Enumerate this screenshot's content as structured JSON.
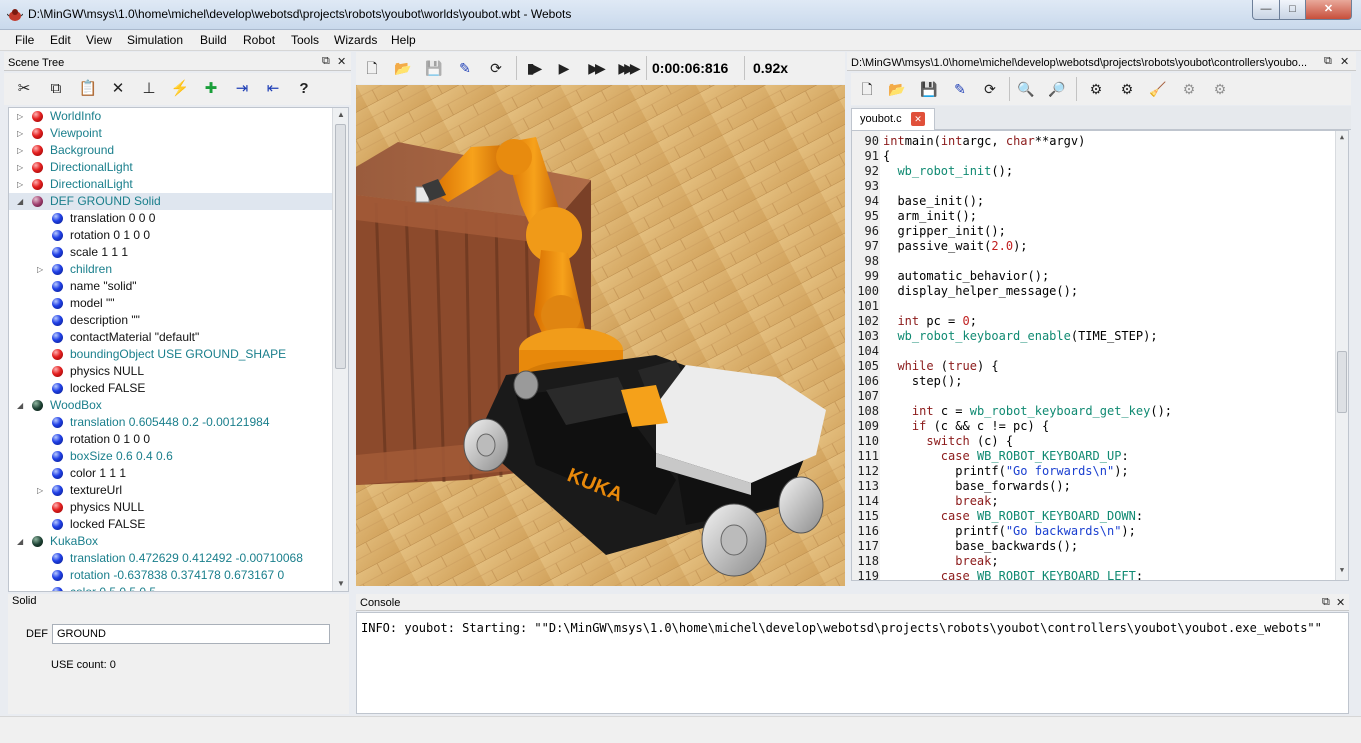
{
  "window": {
    "title": "D:\\MinGW\\msys\\1.0\\home\\michel\\develop\\webotsd\\projects\\robots\\youbot\\worlds\\youbot.wbt - Webots",
    "min_label": "—",
    "max_label": "□",
    "close_label": "✕"
  },
  "menu": [
    "File",
    "Edit",
    "View",
    "Simulation",
    "Build",
    "Robot",
    "Tools",
    "Wizards",
    "Help"
  ],
  "scene_tree": {
    "title": "Scene Tree",
    "toolbar_icons": [
      "cut-icon",
      "copy-icon",
      "paste-icon",
      "delete-icon",
      "reset-icon",
      "lightning-icon",
      "add-node-icon",
      "import-icon",
      "export-icon",
      "help-icon"
    ],
    "toolbar_glyphs": [
      "✂",
      "⧉",
      "📋",
      "✕",
      "⊥",
      "⚡",
      "✚",
      "⇥",
      "⇤",
      "?"
    ],
    "nodes": [
      {
        "label": "WorldInfo",
        "ball": "red",
        "depth": 0,
        "arrow": "▷",
        "color": "teal"
      },
      {
        "label": "Viewpoint",
        "ball": "red",
        "depth": 0,
        "arrow": "▷",
        "color": "teal"
      },
      {
        "label": "Background",
        "ball": "red",
        "depth": 0,
        "arrow": "▷",
        "color": "teal"
      },
      {
        "label": "DirectionalLight",
        "ball": "red",
        "depth": 0,
        "arrow": "▷",
        "color": "teal"
      },
      {
        "label": "DirectionalLight",
        "ball": "red",
        "depth": 0,
        "arrow": "▷",
        "color": "teal"
      },
      {
        "label": "DEF GROUND Solid",
        "ball": "mauve",
        "depth": 0,
        "arrow": "◢",
        "color": "teal",
        "selected": true
      },
      {
        "label": "translation 0 0 0",
        "ball": "blue",
        "depth": 1,
        "arrow": "",
        "color": "black"
      },
      {
        "label": "rotation 0 1 0 0",
        "ball": "blue",
        "depth": 1,
        "arrow": "",
        "color": "black"
      },
      {
        "label": "scale 1 1 1",
        "ball": "blue",
        "depth": 1,
        "arrow": "",
        "color": "black"
      },
      {
        "label": "children",
        "ball": "blue",
        "depth": 1,
        "arrow": "▷",
        "color": "teal"
      },
      {
        "label": "name \"solid\"",
        "ball": "blue",
        "depth": 1,
        "arrow": "",
        "color": "black"
      },
      {
        "label": "model \"\"",
        "ball": "blue",
        "depth": 1,
        "arrow": "",
        "color": "black"
      },
      {
        "label": "description \"\"",
        "ball": "blue",
        "depth": 1,
        "arrow": "",
        "color": "black"
      },
      {
        "label": "contactMaterial \"default\"",
        "ball": "blue",
        "depth": 1,
        "arrow": "",
        "color": "black"
      },
      {
        "label": "boundingObject USE GROUND_SHAPE",
        "ball": "red",
        "depth": 1,
        "arrow": "",
        "color": "teal"
      },
      {
        "label": "physics NULL",
        "ball": "red",
        "depth": 1,
        "arrow": "",
        "color": "black"
      },
      {
        "label": "locked FALSE",
        "ball": "blue",
        "depth": 1,
        "arrow": "",
        "color": "black"
      },
      {
        "label": "WoodBox",
        "ball": "dark",
        "depth": 0,
        "arrow": "◢",
        "color": "teal"
      },
      {
        "label": "translation 0.605448 0.2 -0.00121984",
        "ball": "blue",
        "depth": 1,
        "arrow": "",
        "color": "teal"
      },
      {
        "label": "rotation 0 1 0 0",
        "ball": "blue",
        "depth": 1,
        "arrow": "",
        "color": "black"
      },
      {
        "label": "boxSize 0.6 0.4 0.6",
        "ball": "blue",
        "depth": 1,
        "arrow": "",
        "color": "teal"
      },
      {
        "label": "color 1 1 1",
        "ball": "blue",
        "depth": 1,
        "arrow": "",
        "color": "black"
      },
      {
        "label": "textureUrl",
        "ball": "blue",
        "depth": 1,
        "arrow": "▷",
        "color": "black"
      },
      {
        "label": "physics NULL",
        "ball": "red",
        "depth": 1,
        "arrow": "",
        "color": "black"
      },
      {
        "label": "locked FALSE",
        "ball": "blue",
        "depth": 1,
        "arrow": "",
        "color": "black"
      },
      {
        "label": "KukaBox",
        "ball": "dark",
        "depth": 0,
        "arrow": "◢",
        "color": "teal"
      },
      {
        "label": "translation 0.472629 0.412492 -0.00710068",
        "ball": "blue",
        "depth": 1,
        "arrow": "",
        "color": "teal"
      },
      {
        "label": "rotation -0.637838 0.374178 0.673167 0",
        "ball": "blue",
        "depth": 1,
        "arrow": "",
        "color": "teal"
      },
      {
        "label": "color 0.5 0.5 0.5",
        "ball": "blue",
        "depth": 1,
        "arrow": "",
        "color": "teal"
      }
    ]
  },
  "field_editor": {
    "title": "Solid",
    "def_label": "DEF",
    "def_value": "GROUND",
    "use_count": "USE count: 0"
  },
  "sim_toolbar": {
    "icons": [
      "new-world-icon",
      "open-world-icon",
      "save-world-icon",
      "edit-icon",
      "reload-icon",
      "step-icon",
      "play-icon",
      "fast-icon",
      "fastest-icon"
    ],
    "glyphs": [
      "🗋",
      "📂",
      "💾",
      "✎",
      "⟳",
      "▮▶",
      "▶",
      "▶▶",
      "▶▶▶"
    ],
    "time": "0:00:06:816",
    "speed": "0.92x"
  },
  "editor": {
    "title": "D:\\MinGW\\msys\\1.0\\home\\michel\\develop\\webotsd\\projects\\robots\\youbot\\controllers\\youbo...",
    "tab_label": "youbot.c",
    "tab_close": "✕",
    "toolbar_icons": [
      "new-file-icon",
      "open-file-icon",
      "save-file-icon",
      "save-as-icon",
      "revert-icon",
      "find-icon",
      "replace-icon",
      "build-icon",
      "make-icon",
      "clean-icon",
      "cross-compile-icon",
      "cross-clean-icon"
    ],
    "toolbar_glyphs": [
      "🗋",
      "📂",
      "💾",
      "✎",
      "⟳",
      "🔍",
      "🔎",
      "⚙",
      "⚙",
      "🧹",
      "⚙",
      "⚙"
    ],
    "lines": [
      {
        "n": "90",
        "tokens": [
          [
            "kw",
            "int"
          ],
          [
            "",
            "main("
          ],
          [
            "kw",
            "int"
          ],
          [
            "",
            "argc, "
          ],
          [
            "kw",
            "char"
          ],
          [
            "",
            "**argv)"
          ]
        ]
      },
      {
        "n": "91",
        "tokens": [
          [
            "",
            "{"
          ]
        ]
      },
      {
        "n": "92",
        "tokens": [
          [
            "",
            "  "
          ],
          [
            "fn",
            "wb_robot_init"
          ],
          [
            "",
            "();"
          ]
        ]
      },
      {
        "n": "93",
        "tokens": [
          [
            "",
            ""
          ]
        ]
      },
      {
        "n": "94",
        "tokens": [
          [
            "",
            "  base_init();"
          ]
        ]
      },
      {
        "n": "95",
        "tokens": [
          [
            "",
            "  arm_init();"
          ]
        ]
      },
      {
        "n": "96",
        "tokens": [
          [
            "",
            "  gripper_init();"
          ]
        ]
      },
      {
        "n": "97",
        "tokens": [
          [
            "",
            "  passive_wait("
          ],
          [
            "num",
            "2.0"
          ],
          [
            "",
            ");"
          ]
        ]
      },
      {
        "n": "98",
        "tokens": [
          [
            "",
            ""
          ]
        ]
      },
      {
        "n": "99",
        "tokens": [
          [
            "",
            "  automatic_behavior();"
          ]
        ]
      },
      {
        "n": "100",
        "tokens": [
          [
            "",
            "  display_helper_message();"
          ]
        ]
      },
      {
        "n": "101",
        "tokens": [
          [
            "",
            ""
          ]
        ]
      },
      {
        "n": "102",
        "tokens": [
          [
            "",
            "  "
          ],
          [
            "kw",
            "int"
          ],
          [
            "",
            " pc = "
          ],
          [
            "num",
            "0"
          ],
          [
            "",
            ";"
          ]
        ]
      },
      {
        "n": "103",
        "tokens": [
          [
            "",
            "  "
          ],
          [
            "fn",
            "wb_robot_keyboard_enable"
          ],
          [
            "",
            "(TIME_STEP);"
          ]
        ]
      },
      {
        "n": "104",
        "tokens": [
          [
            "",
            ""
          ]
        ]
      },
      {
        "n": "105",
        "tokens": [
          [
            "",
            "  "
          ],
          [
            "kw",
            "while"
          ],
          [
            "",
            " ("
          ],
          [
            "kw",
            "true"
          ],
          [
            "",
            ") {"
          ]
        ]
      },
      {
        "n": "106",
        "tokens": [
          [
            "",
            "    step();"
          ]
        ]
      },
      {
        "n": "107",
        "tokens": [
          [
            "",
            ""
          ]
        ]
      },
      {
        "n": "108",
        "tokens": [
          [
            "",
            "    "
          ],
          [
            "kw",
            "int"
          ],
          [
            "",
            " c = "
          ],
          [
            "fn",
            "wb_robot_keyboard_get_key"
          ],
          [
            "",
            "();"
          ]
        ]
      },
      {
        "n": "109",
        "tokens": [
          [
            "",
            "    "
          ],
          [
            "kw",
            "if"
          ],
          [
            "",
            " (c && c != pc) {"
          ]
        ]
      },
      {
        "n": "110",
        "tokens": [
          [
            "",
            "      "
          ],
          [
            "kw",
            "switch"
          ],
          [
            "",
            " (c) {"
          ]
        ]
      },
      {
        "n": "111",
        "tokens": [
          [
            "",
            "        "
          ],
          [
            "kw",
            "case"
          ],
          [
            "",
            " "
          ],
          [
            "fn",
            "WB_ROBOT_KEYBOARD_UP"
          ],
          [
            "",
            ":"
          ]
        ]
      },
      {
        "n": "112",
        "tokens": [
          [
            "",
            "          printf("
          ],
          [
            "str",
            "\"Go forwards\\n\""
          ],
          [
            "",
            ");"
          ]
        ]
      },
      {
        "n": "113",
        "tokens": [
          [
            "",
            "          base_forwards();"
          ]
        ]
      },
      {
        "n": "114",
        "tokens": [
          [
            "",
            "          "
          ],
          [
            "kw",
            "break"
          ],
          [
            "",
            ";"
          ]
        ]
      },
      {
        "n": "115",
        "tokens": [
          [
            "",
            "        "
          ],
          [
            "kw",
            "case"
          ],
          [
            "",
            " "
          ],
          [
            "fn",
            "WB_ROBOT_KEYBOARD_DOWN"
          ],
          [
            "",
            ":"
          ]
        ]
      },
      {
        "n": "116",
        "tokens": [
          [
            "",
            "          printf("
          ],
          [
            "str",
            "\"Go backwards\\n\""
          ],
          [
            "",
            ");"
          ]
        ]
      },
      {
        "n": "117",
        "tokens": [
          [
            "",
            "          base_backwards();"
          ]
        ]
      },
      {
        "n": "118",
        "tokens": [
          [
            "",
            "          "
          ],
          [
            "kw",
            "break"
          ],
          [
            "",
            ";"
          ]
        ]
      },
      {
        "n": "119",
        "tokens": [
          [
            "",
            "        "
          ],
          [
            "kw",
            "case"
          ],
          [
            "",
            " "
          ],
          [
            "fn",
            "WB_ROBOT_KEYBOARD_LEFT"
          ],
          [
            "",
            ":"
          ]
        ]
      }
    ]
  },
  "console": {
    "title": "Console",
    "text": "INFO: youbot: Starting: \"\"D:\\MinGW\\msys\\1.0\\home\\michel\\develop\\webotsd\\projects\\robots\\youbot\\controllers\\youbot\\youbot.exe_webots\"\""
  },
  "view3d": {
    "robot_brand": "KUKA"
  },
  "panel_controls": {
    "float": "⧉",
    "close": "✕"
  }
}
